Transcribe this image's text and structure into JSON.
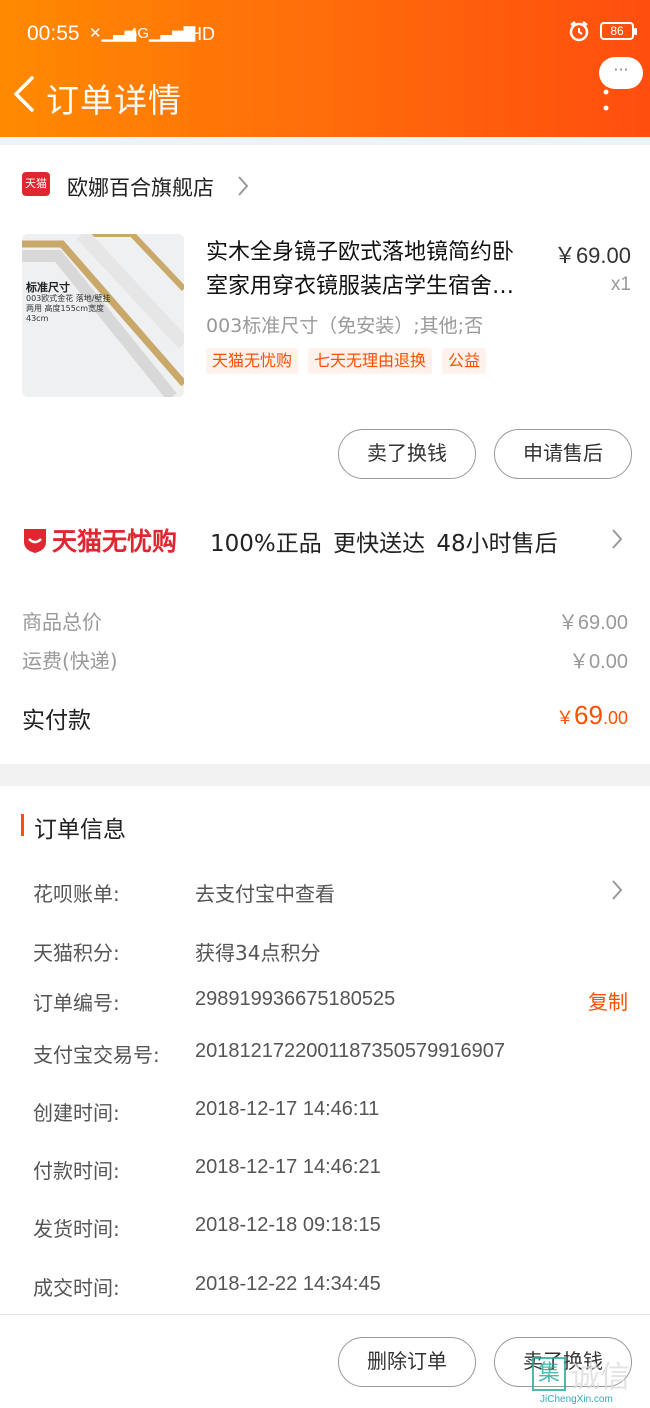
{
  "status_bar": {
    "time": "00:55",
    "network": "4G",
    "hd": "HD",
    "battery": "86"
  },
  "nav": {
    "title": "订单详情",
    "more_bubble": "···"
  },
  "shop": {
    "badge": "天猫",
    "name": "欧娜百合旗舰店"
  },
  "product": {
    "image_label_title": "标准尺寸",
    "image_label_desc": "003欧式金花 落地/壁挂两用 高度155cm宽度43cm",
    "title_line1": "实木全身镜子欧式落地镜简约卧",
    "title_line2": "室家用穿衣镜服装店学生宿舍…",
    "price": "￥69.00",
    "qty": "x1",
    "sku": "003标准尺寸（免安装）;其他;否",
    "tags": [
      "天猫无忧购",
      "七天无理由退换",
      "公益"
    ],
    "buttons": {
      "sell": "卖了换钱",
      "after_sale": "申请售后"
    }
  },
  "worry_free": {
    "name": "天猫无忧购",
    "desc": "100%正品  更快送达  48小时售后"
  },
  "summary": {
    "total_label": "商品总价",
    "total_value": "￥69.00",
    "shipping_label": "运费(快递)",
    "shipping_value": "￥0.00",
    "paid_label": "实付款",
    "paid_currency": "￥",
    "paid_int": "69",
    "paid_dec": ".00"
  },
  "order_info": {
    "title": "订单信息",
    "copy": "复制",
    "rows": [
      {
        "label": "花呗账单:",
        "value": "去支付宝中查看"
      },
      {
        "label": "天猫积分:",
        "value": "获得34点积分"
      },
      {
        "label": "订单编号:",
        "value": "298919936675180525"
      },
      {
        "label": "支付宝交易号:",
        "value": "2018121722001187350579916907"
      },
      {
        "label": "创建时间:",
        "value": "2018-12-17 14:46:11"
      },
      {
        "label": "付款时间:",
        "value": "2018-12-17 14:46:21"
      },
      {
        "label": "发货时间:",
        "value": "2018-12-18 09:18:15"
      },
      {
        "label": "成交时间:",
        "value": "2018-12-22 14:34:45"
      }
    ]
  },
  "bottom": {
    "delete": "删除订单",
    "sell": "卖了换钱"
  },
  "watermark": {
    "box": "集",
    "text": "诚信",
    "sub": "JiChengXin.com"
  },
  "colors": {
    "header_start": "#ff8a00",
    "header_end": "#ff4e0e",
    "accent": "#ff5000",
    "tmall_red": "#e0262f"
  }
}
